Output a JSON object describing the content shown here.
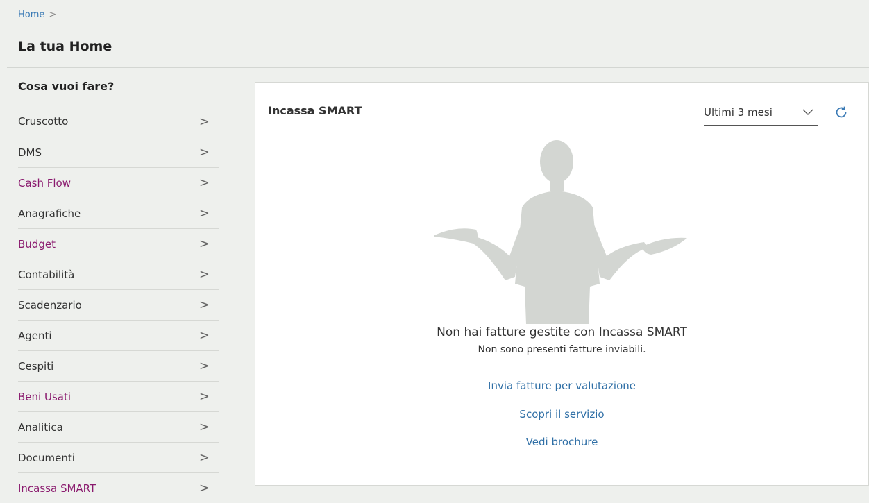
{
  "breadcrumb": {
    "home": "Home",
    "separator": ">"
  },
  "page": {
    "title": "La tua Home"
  },
  "sidebar": {
    "heading": "Cosa vuoi fare?",
    "chevron": ">",
    "items": [
      {
        "label": "Cruscotto",
        "accent": false
      },
      {
        "label": "DMS",
        "accent": false
      },
      {
        "label": "Cash Flow",
        "accent": true
      },
      {
        "label": "Anagrafiche",
        "accent": false
      },
      {
        "label": "Budget",
        "accent": true
      },
      {
        "label": "Contabilità",
        "accent": false
      },
      {
        "label": "Scadenzario",
        "accent": false
      },
      {
        "label": "Agenti",
        "accent": false
      },
      {
        "label": "Cespiti",
        "accent": false
      },
      {
        "label": "Beni Usati",
        "accent": true
      },
      {
        "label": "Analitica",
        "accent": false
      },
      {
        "label": "Documenti",
        "accent": false
      },
      {
        "label": "Incassa SMART",
        "accent": true
      }
    ]
  },
  "panel": {
    "title": "Incassa SMART",
    "period_select": {
      "value": "Ultimi 3 mesi"
    },
    "empty_state": {
      "title": "Non hai fatture gestite con Incassa SMART",
      "subtitle": "Non sono presenti fatture inviabili."
    },
    "links": {
      "send": "Invia fatture per valutazione",
      "discover": "Scopri il servizio",
      "brochure": "Vedi brochure"
    }
  },
  "colors": {
    "accent": "#8a1a6e",
    "link": "#2f6fa6",
    "background": "#eef0ed",
    "illustration": "#d3d6d2"
  },
  "icons": {
    "refresh": "refresh-icon",
    "chevron_right": "chevron-right-icon",
    "chevron_down": "chevron-down-icon"
  }
}
